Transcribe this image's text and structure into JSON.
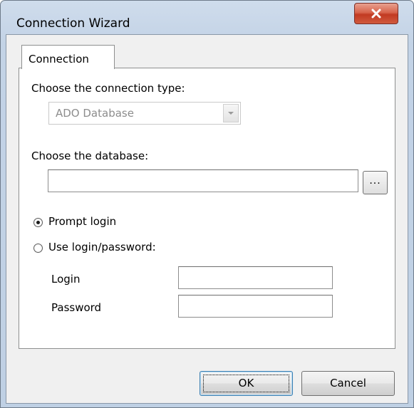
{
  "window": {
    "title": "Connection Wizard"
  },
  "tabs": [
    {
      "label": "Connection"
    }
  ],
  "connection_type": {
    "label": "Choose the connection type:",
    "selected": "ADO Database"
  },
  "database": {
    "label": "Choose the database:",
    "value": "",
    "browse_label": "..."
  },
  "login_mode": {
    "prompt_label": "Prompt login",
    "use_label": "Use login/password:",
    "selected": "Prompt login"
  },
  "credentials": {
    "login_label": "Login",
    "login_value": "",
    "password_label": "Password",
    "password_value": ""
  },
  "buttons": {
    "ok": "OK",
    "cancel": "Cancel"
  }
}
